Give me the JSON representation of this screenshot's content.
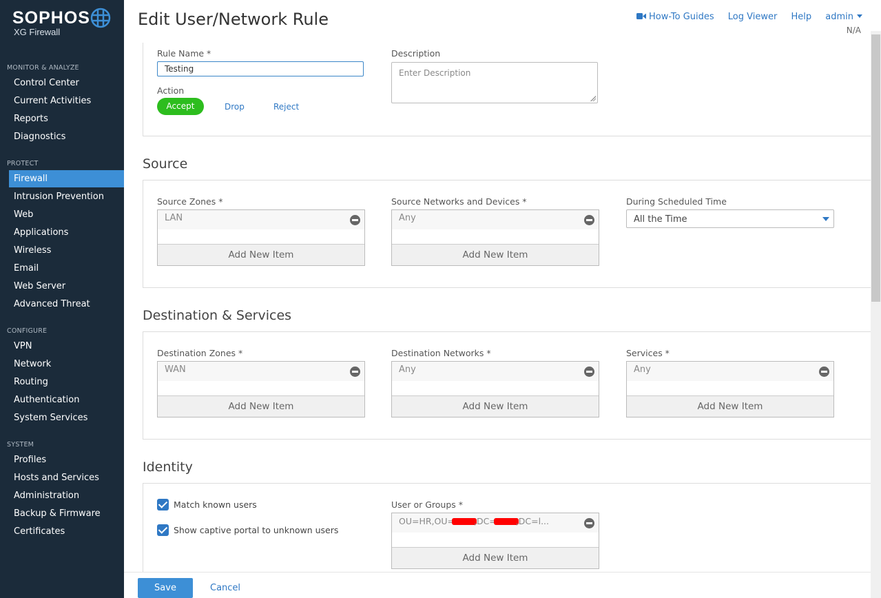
{
  "sidebar": {
    "brand": "SOPHOS",
    "product": "XG Firewall",
    "sections": [
      {
        "title": "MONITOR & ANALYZE",
        "items": [
          "Control Center",
          "Current Activities",
          "Reports",
          "Diagnostics"
        ]
      },
      {
        "title": "PROTECT",
        "items": [
          "Firewall",
          "Intrusion Prevention",
          "Web",
          "Applications",
          "Wireless",
          "Email",
          "Web Server",
          "Advanced Threat"
        ]
      },
      {
        "title": "CONFIGURE",
        "items": [
          "VPN",
          "Network",
          "Routing",
          "Authentication",
          "System Services"
        ]
      },
      {
        "title": "SYSTEM",
        "items": [
          "Profiles",
          "Hosts and Services",
          "Administration",
          "Backup & Firmware",
          "Certificates"
        ]
      }
    ],
    "active_item": "Firewall"
  },
  "header": {
    "title": "Edit User/Network Rule",
    "links": [
      "How-To Guides",
      "Log Viewer",
      "Help",
      "admin"
    ],
    "subtext": "N/A"
  },
  "rule": {
    "name_label": "Rule Name *",
    "name_value": "Testing",
    "description_label": "Description",
    "description_placeholder": "Enter Description",
    "action_label": "Action",
    "actions": [
      "Accept",
      "Drop",
      "Reject"
    ],
    "selected_action": "Accept"
  },
  "source": {
    "heading": "Source",
    "zones_label": "Source Zones *",
    "zones_value": "LAN",
    "networks_label": "Source Networks and Devices *",
    "networks_value": "Any",
    "schedule_label": "During Scheduled Time",
    "schedule_value": "All the Time"
  },
  "destination": {
    "heading": "Destination & Services",
    "zones_label": "Destination Zones *",
    "zones_value": "WAN",
    "networks_label": "Destination Networks *",
    "networks_value": "Any",
    "services_label": "Services *",
    "services_value": "Any"
  },
  "identity": {
    "heading": "Identity",
    "match_known_label": "Match known users",
    "match_known_checked": true,
    "captive_portal_label": "Show captive portal to unknown users",
    "captive_portal_checked": true,
    "users_label": "User or Groups *",
    "users_value_parts": [
      "OU=HR,OU=",
      ",DC=",
      ",DC=l..."
    ]
  },
  "common": {
    "add_new_item": "Add New Item"
  },
  "footer": {
    "save_label": "Save",
    "cancel_label": "Cancel"
  },
  "colors": {
    "sidebar_bg": "#1b2b3a",
    "accent": "#3d8fd6",
    "accept_green": "#2dbd1e",
    "link": "#2f78c4"
  }
}
